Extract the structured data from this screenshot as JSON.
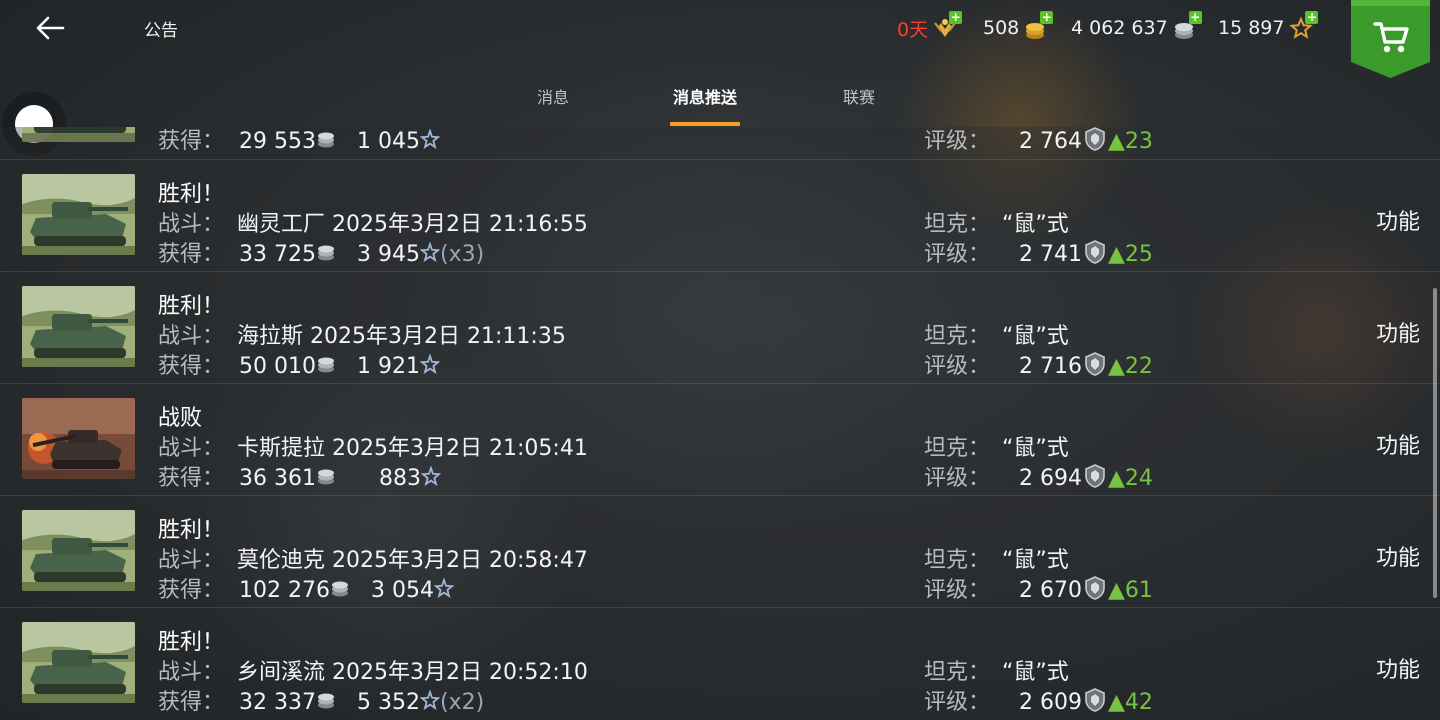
{
  "header": {
    "title": "公告",
    "premium_days": "0天",
    "gold": "508",
    "credits": "4 062 637",
    "free_xp": "15 897"
  },
  "tabs": [
    {
      "label": "消息",
      "active": false
    },
    {
      "label": "消息推送",
      "active": true
    },
    {
      "label": "联赛",
      "active": false
    }
  ],
  "labels": {
    "battle": "战斗：",
    "reward": "获得：",
    "tank": "坦克：",
    "rating": "评级：",
    "function": "功能"
  },
  "partial_row": {
    "credits": "29 553",
    "xp": "1 045",
    "rating": "2 764",
    "rating_gain": "▲23"
  },
  "battles": [
    {
      "result": "胜利！",
      "victory": true,
      "map": "幽灵工厂",
      "datetime": "2025年3月2日 21:16:55",
      "credits": "33 725",
      "xp": "3 945",
      "multiplier": "(x3)",
      "tank": "“鼠”式",
      "rating": "2 741",
      "rating_gain": "▲25"
    },
    {
      "result": "胜利！",
      "victory": true,
      "map": "海拉斯",
      "datetime": "2025年3月2日 21:11:35",
      "credits": "50 010",
      "xp": "1 921",
      "multiplier": "",
      "tank": "“鼠”式",
      "rating": "2 716",
      "rating_gain": "▲22"
    },
    {
      "result": "战败",
      "victory": false,
      "map": "卡斯提拉",
      "datetime": "2025年3月2日 21:05:41",
      "credits": "36 361",
      "xp": "883",
      "multiplier": "",
      "tank": "“鼠”式",
      "rating": "2 694",
      "rating_gain": "▲24"
    },
    {
      "result": "胜利！",
      "victory": true,
      "map": "莫伦迪克",
      "datetime": "2025年3月2日 20:58:47",
      "credits": "102 276",
      "xp": "3 054",
      "multiplier": "",
      "tank": "“鼠”式",
      "rating": "2 670",
      "rating_gain": "▲61"
    },
    {
      "result": "胜利！",
      "victory": true,
      "map": "乡间溪流",
      "datetime": "2025年3月2日 20:52:10",
      "credits": "32 337",
      "xp": "5 352",
      "multiplier": "(x2)",
      "tank": "“鼠”式",
      "rating": "2 609",
      "rating_gain": "▲42"
    }
  ],
  "icons": {
    "back": "back-arrow-icon",
    "premium": "premium-wings-icon",
    "gold": "gold-coins-icon",
    "credits": "silver-coins-icon",
    "free_xp": "free-xp-star-icon",
    "shop": "shopping-cart-icon",
    "rating": "rating-shield-icon"
  },
  "colors": {
    "tab_underline": "#f6a21c",
    "premium_text": "#ff3b30",
    "plus_badge": "#5cc22a",
    "shop_green": "#3a9a2a",
    "rating_gain": "#76c442"
  }
}
